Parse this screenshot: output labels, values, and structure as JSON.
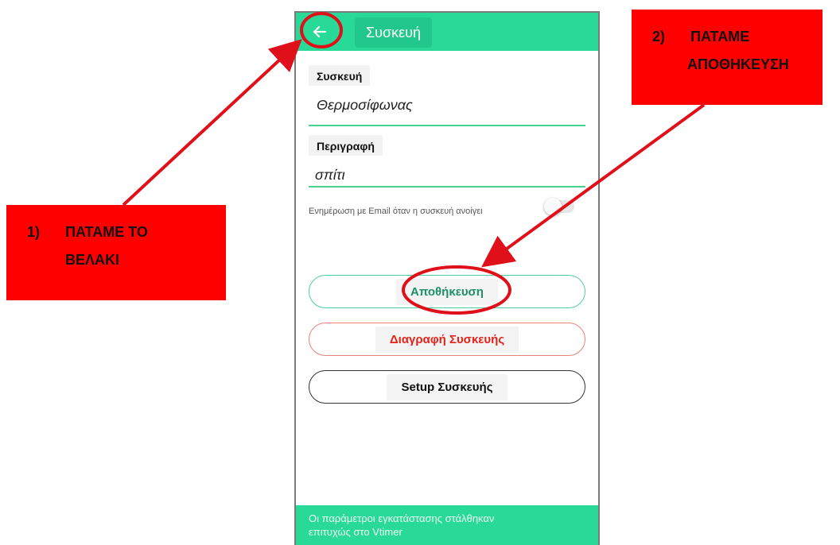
{
  "appbar": {
    "title": "Συσκευή",
    "back_icon": "arrow-left-icon",
    "background": "#29d998"
  },
  "form": {
    "device_label": "Συσκευή",
    "device_value": "Θερμοσίφωνας",
    "description_label": "Περιγραφή",
    "description_value": "σπίτι",
    "notify_label": "Ενημέρωση με Email όταν η συσκευή ανοίγει",
    "notify_enabled": false
  },
  "buttons": {
    "save": "Αποθήκευση",
    "delete": "Διαγραφή Συσκευής",
    "setup": "Setup Συσκευής"
  },
  "snackbar": {
    "line1": "Οι παράμετροι εγκατάστασης στάλθηκαν",
    "line2": "επιτυχώς στο Vtimer"
  },
  "annotations": {
    "step1": {
      "number": "1)",
      "line1": "ΠΑΤΑΜΕ ΤΟ",
      "line2": "ΒΕΛΑΚΙ"
    },
    "step2": {
      "number": "2)",
      "line1": "ΠΑΤΑΜΕ",
      "line2": "ΑΠΟΘΗΚΕΥΣΗ"
    },
    "highlight_color": "#e0101a",
    "callout_color": "#ff0000"
  }
}
